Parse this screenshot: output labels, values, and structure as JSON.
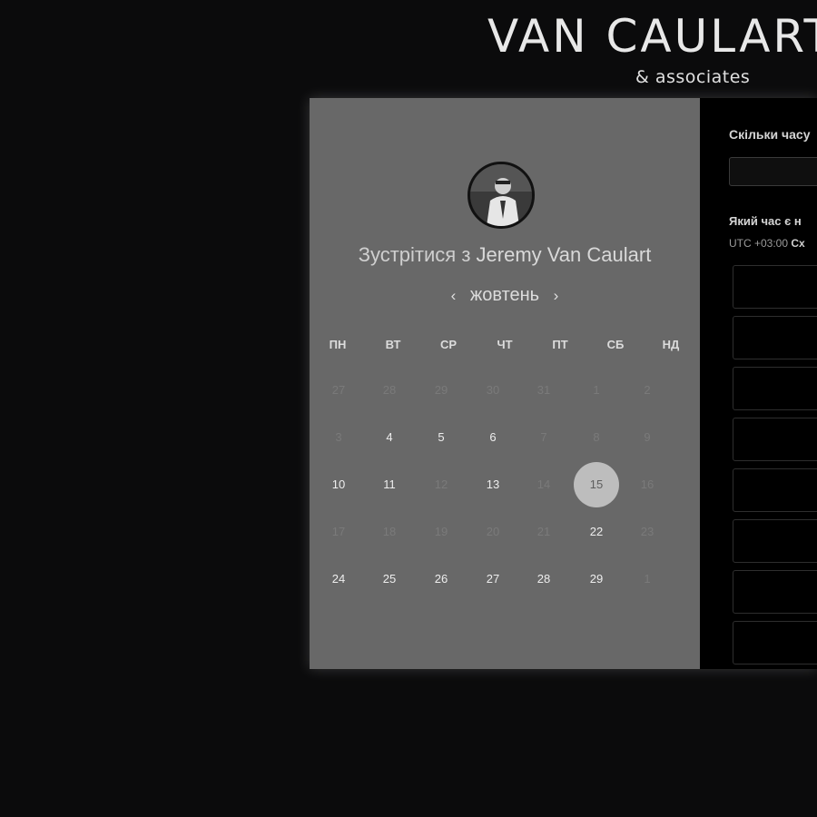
{
  "brand": {
    "title": "VAN CAULART",
    "subtitle": "& associates"
  },
  "calendar": {
    "host_prefix": "Зустрітися з",
    "host_name": "Jeremy Van Caulart",
    "month": "жовтень",
    "prev_icon": "‹",
    "next_icon": "›",
    "weekdays": [
      "ПН",
      "ВТ",
      "СР",
      "ЧТ",
      "ПТ",
      "СБ",
      "НД"
    ],
    "weeks": [
      [
        {
          "d": "27",
          "s": "muted"
        },
        {
          "d": "28",
          "s": "muted"
        },
        {
          "d": "29",
          "s": "muted"
        },
        {
          "d": "30",
          "s": "muted"
        },
        {
          "d": "31",
          "s": "muted"
        },
        {
          "d": "1",
          "s": "muted"
        },
        {
          "d": "2",
          "s": "muted"
        }
      ],
      [
        {
          "d": "3",
          "s": "muted"
        },
        {
          "d": "4",
          "s": "avail"
        },
        {
          "d": "5",
          "s": "avail"
        },
        {
          "d": "6",
          "s": "avail"
        },
        {
          "d": "7",
          "s": "muted"
        },
        {
          "d": "8",
          "s": "muted"
        },
        {
          "d": "9",
          "s": "muted"
        }
      ],
      [
        {
          "d": "10",
          "s": "avail"
        },
        {
          "d": "11",
          "s": "avail"
        },
        {
          "d": "12",
          "s": "muted"
        },
        {
          "d": "13",
          "s": "avail"
        },
        {
          "d": "14",
          "s": "muted"
        },
        {
          "d": "15",
          "s": "selected"
        },
        {
          "d": "16",
          "s": "muted"
        }
      ],
      [
        {
          "d": "17",
          "s": "muted"
        },
        {
          "d": "18",
          "s": "muted"
        },
        {
          "d": "19",
          "s": "muted"
        },
        {
          "d": "20",
          "s": "muted"
        },
        {
          "d": "21",
          "s": "muted"
        },
        {
          "d": "22",
          "s": "avail"
        },
        {
          "d": "23",
          "s": "muted"
        }
      ],
      [
        {
          "d": "24",
          "s": "avail"
        },
        {
          "d": "25",
          "s": "avail"
        },
        {
          "d": "26",
          "s": "avail"
        },
        {
          "d": "27",
          "s": "avail"
        },
        {
          "d": "28",
          "s": "avail"
        },
        {
          "d": "29",
          "s": "avail"
        },
        {
          "d": "1",
          "s": "muted"
        }
      ]
    ]
  },
  "booking": {
    "duration_question": "Скільки часу",
    "time_question": "Який час є н",
    "timezone_prefix": "UTC +03:00",
    "timezone_name": "Сх",
    "visible_slots": 8
  },
  "colors": {
    "page_bg": "#0b0b0c",
    "calendar_bg": "#686868",
    "selected_day": "#bdbdbd"
  }
}
